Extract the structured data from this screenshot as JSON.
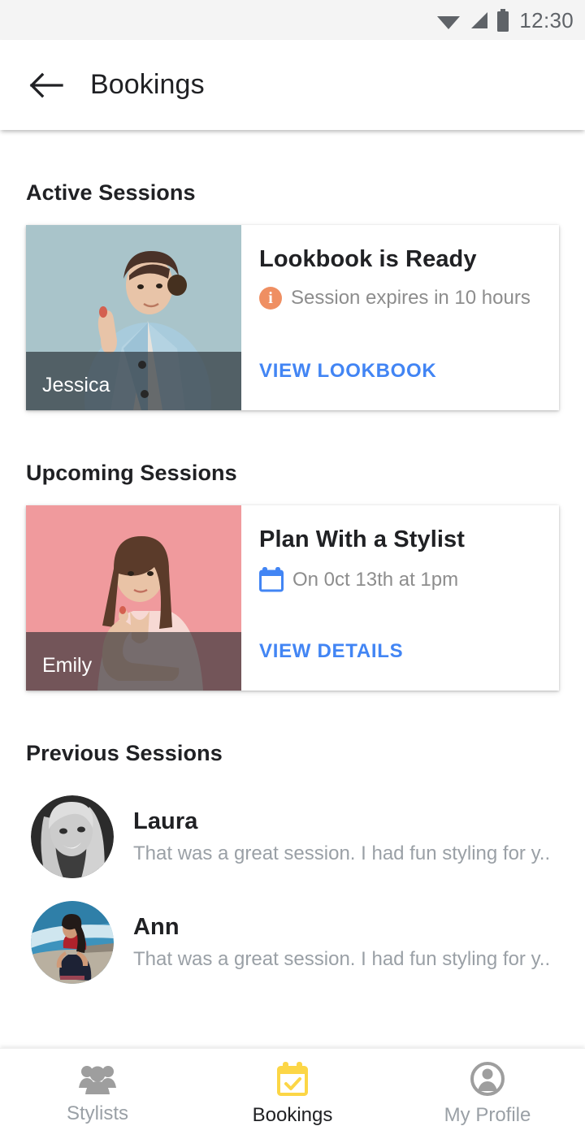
{
  "status_bar": {
    "time": "12:30",
    "icons": [
      "wifi-icon",
      "cell-signal-icon",
      "battery-icon"
    ],
    "background": "#f4f4f4",
    "text_color": "#5f6368"
  },
  "app_bar": {
    "back_icon": "arrow-left-icon",
    "title": "Bookings"
  },
  "colors": {
    "accent_blue": "#4285f4",
    "info_orange": "#ef8f62",
    "active_nav_yellow": "#fcd646",
    "muted_text": "#9aa0a6",
    "primary_text": "#202124",
    "page_background": "#ffffff"
  },
  "sections": {
    "active": {
      "title": "Active Sessions",
      "card": {
        "stylist_name": "Jessica",
        "title": "Lookbook is Ready",
        "subtitle": "Session expires in 10 hours",
        "subtitle_icon": "info-icon",
        "action_label": "VIEW LOOKBOOK",
        "photo": {
          "alt": "Jessica pointing, light blue blazer",
          "background": "#a9c4ca",
          "garment": "#a8cbdc",
          "skin": "#e8c4a8",
          "hair": "#4a3228"
        }
      }
    },
    "upcoming": {
      "title": "Upcoming Sessions",
      "card": {
        "stylist_name": "Emily",
        "title": "Plan With a Stylist",
        "subtitle": "On 0ct 13th at 1pm",
        "subtitle_icon": "calendar-icon",
        "action_label": "VIEW DETAILS",
        "photo": {
          "alt": "Emily with hand on chin, pale pink top",
          "background": "#f09a9d",
          "garment": "#f7d9d4",
          "skin": "#e9c3a6",
          "hair": "#5b3b2a"
        }
      }
    },
    "previous": {
      "title": "Previous Sessions",
      "items": [
        {
          "name": "Laura",
          "message": "That was a great session. I had fun styling for y..",
          "avatar": {
            "alt": "Laura black and white portrait",
            "style": "grayscale",
            "background": "#2b2b2b",
            "hair": "#d8d8d8",
            "skin": "#cccccc"
          }
        },
        {
          "name": "Ann",
          "message": "That was a great session. I had fun styling for y..",
          "avatar": {
            "alt": "Ann at the coast, red top and dark skirt",
            "style": "color",
            "background": "#2f7fa8",
            "ocean": "#3d93bd",
            "foam": "#cfe6ef",
            "rock": "#b9b0a0",
            "top": "#b0222b",
            "skirt": "#1d2235",
            "hair": "#221a18",
            "skin": "#cf9a78"
          }
        }
      ]
    }
  },
  "bottom_nav": {
    "items": [
      {
        "label": "Stylists",
        "icon": "people-group-icon",
        "active": false
      },
      {
        "label": "Bookings",
        "icon": "calendar-check-icon",
        "active": true
      },
      {
        "label": "My Profile",
        "icon": "account-circle-icon",
        "active": false
      }
    ]
  }
}
